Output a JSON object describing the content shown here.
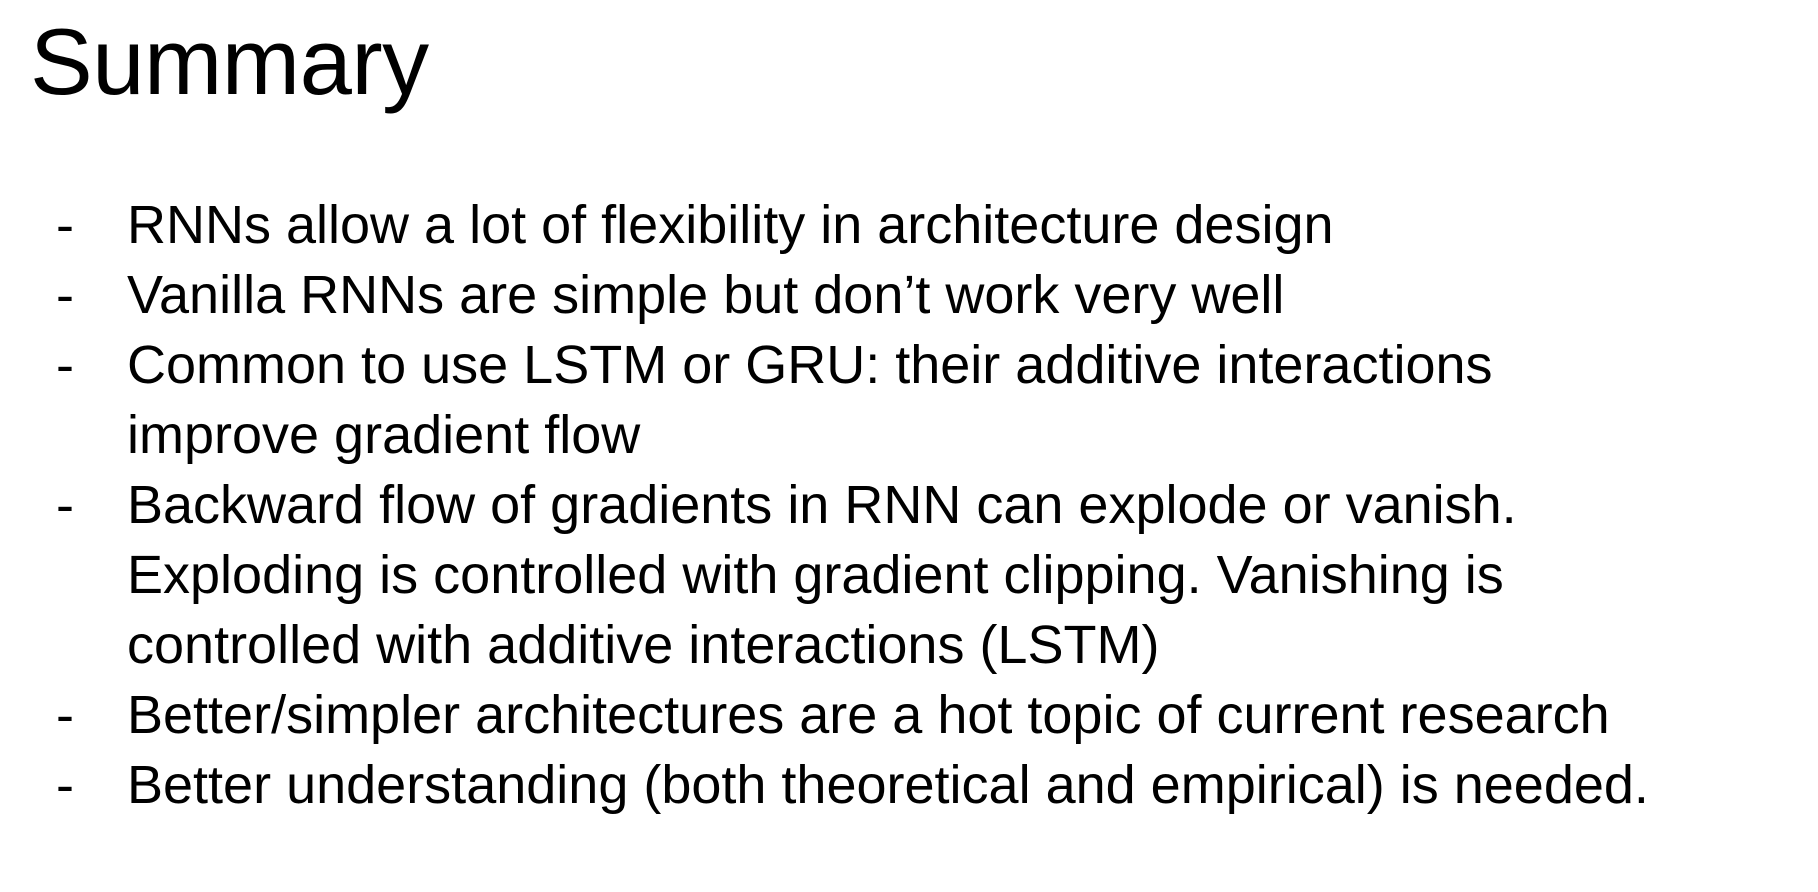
{
  "slide": {
    "title": "Summary",
    "bullet_marker": "-",
    "bullets": [
      {
        "lines": [
          "RNNs allow a lot of flexibility in architecture design"
        ]
      },
      {
        "lines": [
          "Vanilla RNNs are simple but don’t work very well"
        ]
      },
      {
        "lines": [
          "Common to use LSTM or GRU: their additive interactions",
          "improve gradient flow"
        ]
      },
      {
        "lines": [
          "Backward flow of gradients in RNN can explode or vanish.",
          "Exploding is controlled with gradient clipping. Vanishing is",
          "controlled with additive interactions (LSTM)"
        ]
      },
      {
        "lines": [
          "Better/simpler architectures are a hot topic of current research"
        ]
      },
      {
        "lines": [
          "Better understanding (both theoretical and empirical) is needed."
        ]
      }
    ]
  }
}
